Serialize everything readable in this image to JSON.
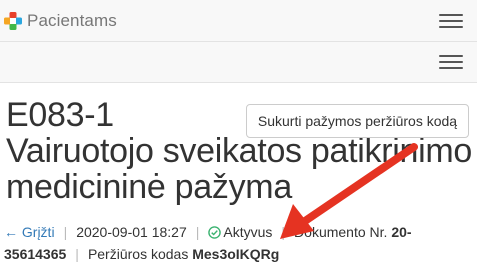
{
  "navbar": {
    "brand": "Pacientams",
    "logo_icon": "medical-cross-logo",
    "menu_icon": "hamburger-menu-icon"
  },
  "subbar": {
    "menu_icon": "hamburger-menu-icon"
  },
  "document": {
    "code": "E083-1",
    "title_line1": "Vairuotojo sveikatos patikrinimo",
    "title_line2": "medicininė pažyma"
  },
  "actions": {
    "create_code_label": "Sukurti pažymos peržiūros kodą"
  },
  "meta": {
    "back_label": "← Grįžti",
    "datetime": "2020-09-01 18:27",
    "status_label": "Aktyvus",
    "doc_number_label": "Dokumento Nr.",
    "doc_number_part1": "20-",
    "doc_number_part2": "35614365",
    "review_code_label": "Peržiūros kodas",
    "review_code_value": "Mes3oIKQRg"
  },
  "colors": {
    "link": "#337ab7",
    "status": "#3cb371",
    "annotation_arrow": "#e53322"
  }
}
